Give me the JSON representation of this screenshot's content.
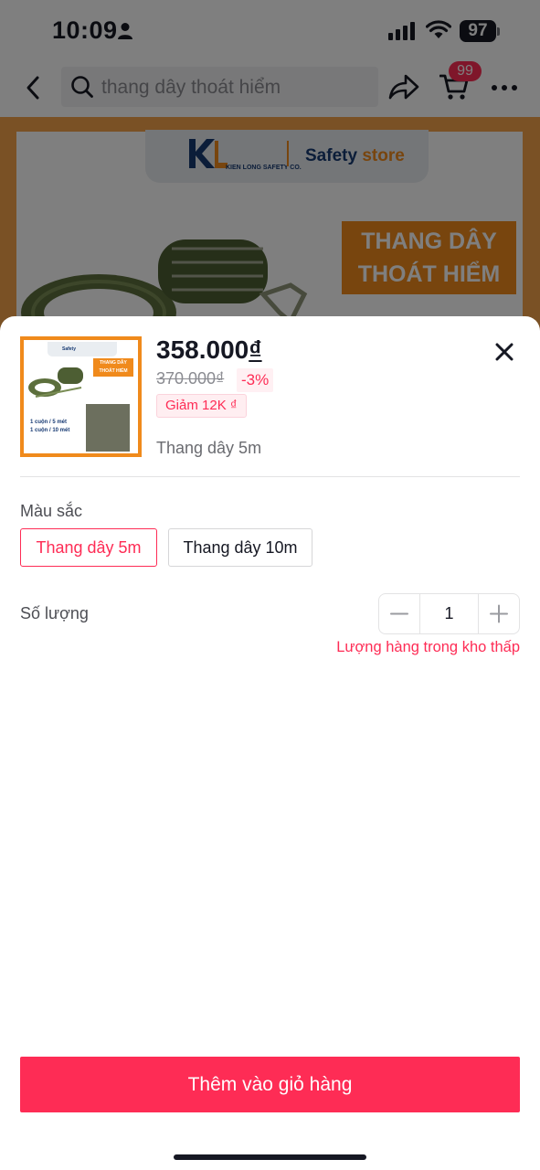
{
  "status_bar": {
    "time": "10:09",
    "battery": "97"
  },
  "nav": {
    "search_text": "thang dây thoát hiểm",
    "cart_count": "99"
  },
  "banner": {
    "brand_name": "KIEN LONG SAFETY CO.",
    "store_word": "Safety",
    "store_accent": "store",
    "title_line1": "THANG DÂY",
    "title_line2": "THOÁT HIỂM"
  },
  "product": {
    "thumb_line1": "1 cuộn /  5 mét",
    "thumb_line2": "1 cuộn /  10 mét",
    "thumb_title": "THANG DÂY THOÁT HIỂM",
    "price": "358.000",
    "currency": "₫",
    "original_price": "370.000₫",
    "discount": "-3%",
    "voucher": "Giảm 12K ₫",
    "selected_variant": "Thang dây 5m"
  },
  "options": {
    "color_label": "Màu sắc",
    "variants": [
      {
        "label": "Thang dây 5m",
        "selected": true
      },
      {
        "label": "Thang dây 10m",
        "selected": false
      }
    ]
  },
  "quantity": {
    "label": "Số lượng",
    "value": "1",
    "stock_warning": "Lượng hàng trong kho thấp"
  },
  "cta": {
    "add_to_cart": "Thêm vào giỏ hàng"
  },
  "colors": {
    "accent": "#fe2c55",
    "brand_orange": "#f08a1c",
    "brand_navy": "#173a73"
  }
}
